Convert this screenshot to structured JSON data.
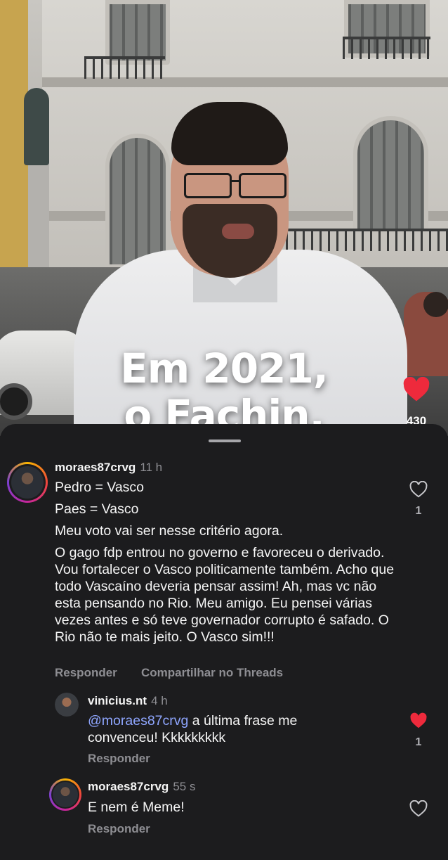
{
  "video": {
    "caption_line1": "Em 2021,",
    "caption_line2": "o Fachin,",
    "like_icon": "heart-filled-icon",
    "like_color": "#ee2a3c",
    "like_count": "430"
  },
  "comments": [
    {
      "username": "moraes87crvg",
      "time": "11 h",
      "avatar_ring": true,
      "paragraphs": [
        "Pedro = Vasco",
        "Paes = Vasco",
        "Meu voto vai ser nesse critério agora.",
        "O gago fdp entrou no governo e favoreceu o derivado. Vou fortalecer o Vasco politicamente também. Acho que todo Vascaíno deveria pensar assim! Ah, mas vc não esta pensando no Rio. Meu amigo. Eu pensei várias vezes antes e só teve governador corrupto é safado. O Rio não te mais jeito. O Vasco sim!!!"
      ],
      "reply_label": "Responder",
      "share_label": "Compartilhar no Threads",
      "liked": false,
      "like_count": "1"
    },
    {
      "username": "vinicius.nt",
      "time": "4 h",
      "mention": "@moraes87crvg",
      "text": " a última frase me convenceu! Kkkkkkkkk",
      "reply_label": "Responder",
      "liked": true,
      "like_count": "1"
    },
    {
      "username": "moraes87crvg",
      "time": "55 s",
      "text": "E nem é Meme!",
      "reply_label": "Responder",
      "liked": false
    }
  ],
  "colors": {
    "sheet_bg": "#1c1c1e",
    "muted_text": "#8e8e93",
    "mention": "#8fa6ff",
    "liked_heart": "#ee2a3c"
  }
}
